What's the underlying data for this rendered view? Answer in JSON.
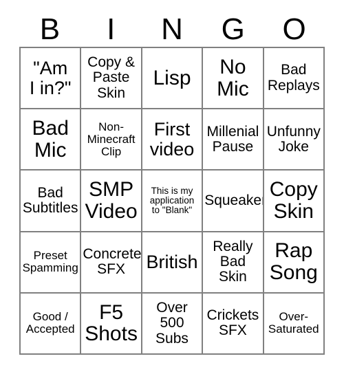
{
  "card": {
    "title_letters": [
      "B",
      "I",
      "N",
      "G",
      "O"
    ],
    "columns": 5,
    "rows": 5,
    "border_color": "#808080",
    "text_color": "#000000",
    "background_color": "#ffffff",
    "cells": [
      {
        "text": "\"Am\nI in?\"",
        "size": "lg"
      },
      {
        "text": "Copy &\nPaste\nSkin",
        "size": "md"
      },
      {
        "text": "Lisp",
        "size": "xl"
      },
      {
        "text": "No\nMic",
        "size": "xl"
      },
      {
        "text": "Bad\nReplays",
        "size": "md"
      },
      {
        "text": "Bad\nMic",
        "size": "xl"
      },
      {
        "text": "Non-\nMinecraft\nClip",
        "size": "sm"
      },
      {
        "text": "First\nvideo",
        "size": "lg"
      },
      {
        "text": "Millenial\nPause",
        "size": "md"
      },
      {
        "text": "Unfunny\nJoke",
        "size": "md"
      },
      {
        "text": "Bad\nSubtitles",
        "size": "md"
      },
      {
        "text": "SMP\nVideo",
        "size": "xl"
      },
      {
        "text": "This is my\napplication\nto \"Blank\"",
        "size": "xs"
      },
      {
        "text": "Squeaker",
        "size": "md"
      },
      {
        "text": "Copy\nSkin",
        "size": "xl"
      },
      {
        "text": "Preset\nSpamming",
        "size": "sm"
      },
      {
        "text": "Concrete\nSFX",
        "size": "md"
      },
      {
        "text": "British",
        "size": "lg"
      },
      {
        "text": "Really\nBad\nSkin",
        "size": "md"
      },
      {
        "text": "Rap\nSong",
        "size": "xl"
      },
      {
        "text": "Good /\nAccepted",
        "size": "sm"
      },
      {
        "text": "F5\nShots",
        "size": "xl"
      },
      {
        "text": "Over\n500\nSubs",
        "size": "md"
      },
      {
        "text": "Crickets\nSFX",
        "size": "md"
      },
      {
        "text": "Over-\nSaturated",
        "size": "sm"
      }
    ]
  }
}
